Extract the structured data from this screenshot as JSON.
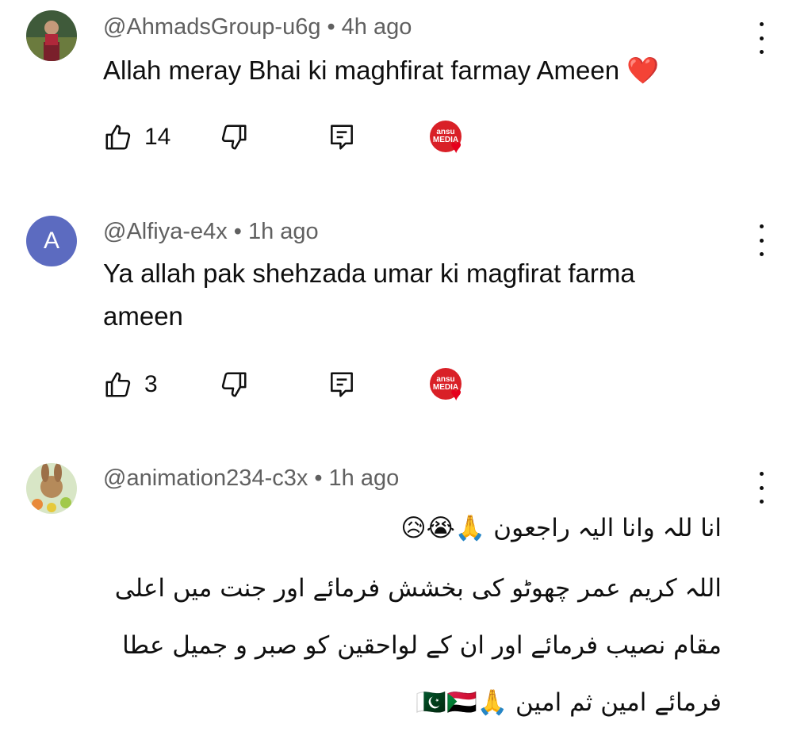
{
  "comments": [
    {
      "avatar": "photo-avatar",
      "author": "@AhmadsGroup-u6g",
      "time": "4h ago",
      "text": "Allah meray Bhai ki maghfirat farmay Ameen",
      "emoji": "❤️",
      "likes": "14",
      "badge_text": "ansu MEDIA"
    },
    {
      "avatar_letter": "A",
      "avatar_color": "#5c6bc0",
      "author": "@Alfiya-e4x",
      "time": "1h ago",
      "text": "Ya allah pak shehzada umar ki magfirat farma ameen",
      "likes": "3",
      "badge_text": "ansu MEDIA"
    },
    {
      "avatar": "photo-avatar",
      "author": "@animation234-c3x",
      "time": "1h ago",
      "lines": [
        "انا للہ وانا الیہ راجعون 🙏😭😥",
        "اللہ کریم عمر چھوٹو کی بخشش فرمائے اور جنت میں اعلی",
        "مقام نصیب فرمائے اور ان کے لواحقین کو صبر و جمیل عطا",
        "فرمائے امین ثم امین 🙏🇵🇰🇸🇩"
      ]
    }
  ],
  "icons": {
    "like": "thumb-up-icon",
    "dislike": "thumb-down-icon",
    "reply": "reply-icon",
    "more": "more-vert-icon"
  }
}
